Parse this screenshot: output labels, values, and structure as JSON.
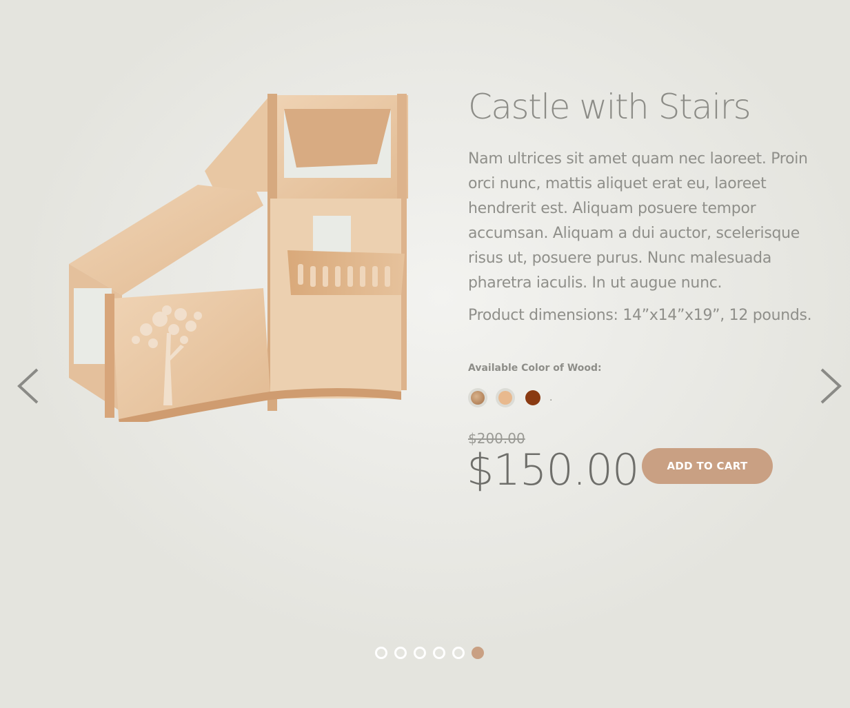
{
  "product": {
    "title": "Castle with Stairs",
    "description": "Nam ultrices sit amet quam nec laoreet. Proin orci nunc, mattis aliquet erat eu, laoreet hendrerit est. Aliquam posuere tempor accumsan. Aliquam a dui auctor, scelerisque risus ut, posuere purus. Nunc malesuada pharetra iaculis. In ut augue nunc.",
    "dimensions": "Product dimensions: 14”x14”x19”, 12 pounds.",
    "color_label": "Available Color of Wood",
    "color_label_suffix": ":",
    "swatches": [
      {
        "name": "natural-grain",
        "color": "#c8a07c"
      },
      {
        "name": "light-maple",
        "color": "#e8b98e"
      },
      {
        "name": "dark-walnut",
        "color": "#8a3a12"
      }
    ],
    "swatch_tail": ".",
    "old_price": "$200.00",
    "price": "$150.00",
    "add_to_cart": "ADD TO CART"
  },
  "slider": {
    "total_slides": 6,
    "active_slide": 6
  },
  "colors": {
    "accent": "#c9a083",
    "title": "#8c8c87",
    "price": "#6e6e6a"
  }
}
